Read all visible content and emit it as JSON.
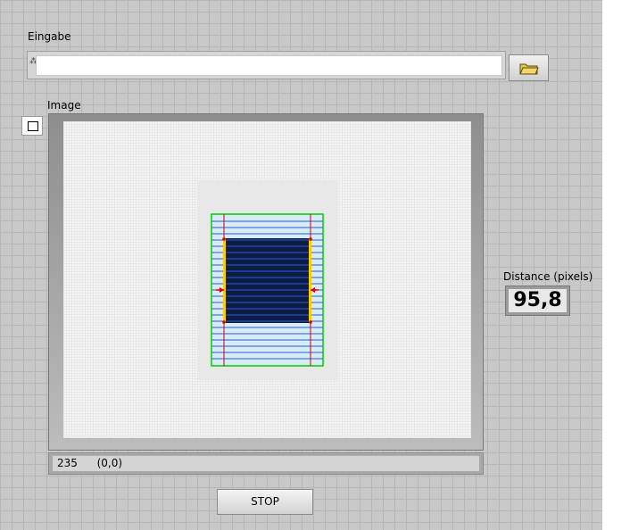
{
  "eingabe": {
    "label": "Eingabe",
    "value": ""
  },
  "image": {
    "label": "Image",
    "status_value": "235",
    "status_coords": "(0,0)"
  },
  "distance": {
    "label": "Distance (pixels)",
    "value": "95,8"
  },
  "stop": {
    "label": "STOP"
  },
  "icons": {
    "path": "path-icon",
    "browse": "folder-icon",
    "toggle": "square-icon"
  },
  "colors": {
    "background": "#c8c8c8",
    "roi_green": "#00cc00",
    "edge_red": "#d40000",
    "scan_blue": "#2a5bd7",
    "object_fill": "#0b1b44"
  }
}
